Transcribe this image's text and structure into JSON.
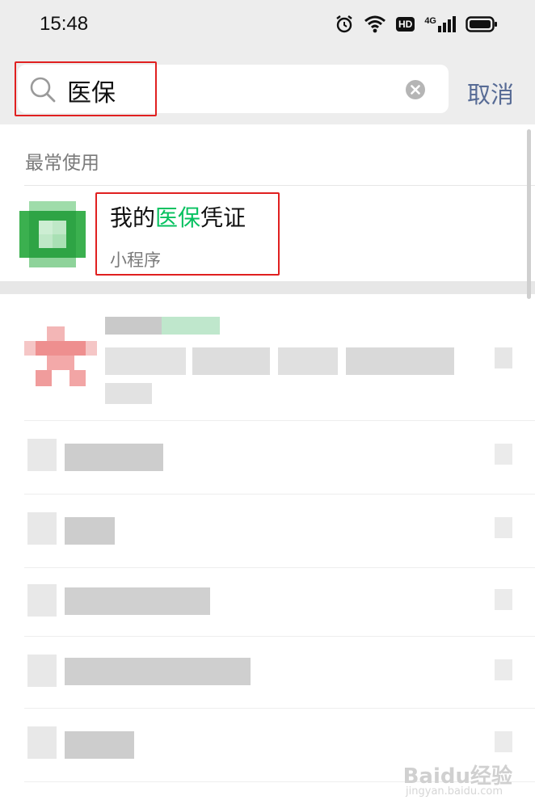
{
  "status_bar": {
    "time": "15:48",
    "icons": [
      "alarm-icon",
      "wifi-icon",
      "hd-icon",
      "4g-signal-icon",
      "battery-icon"
    ],
    "hd_label": "HD",
    "network_label": "4G"
  },
  "search": {
    "query": "医保",
    "cancel_label": "取消"
  },
  "frequent": {
    "section_title": "最常使用",
    "item": {
      "title_prefix": "我的",
      "title_highlight": "医保",
      "title_suffix": "凭证",
      "subtitle": "小程序"
    }
  },
  "watermark": {
    "text": "Baidu经验",
    "sub": "jingyan.baidu.com"
  },
  "colors": {
    "highlight": "#07c160",
    "cancel": "#576b95",
    "annotation_box": "#e02020"
  }
}
